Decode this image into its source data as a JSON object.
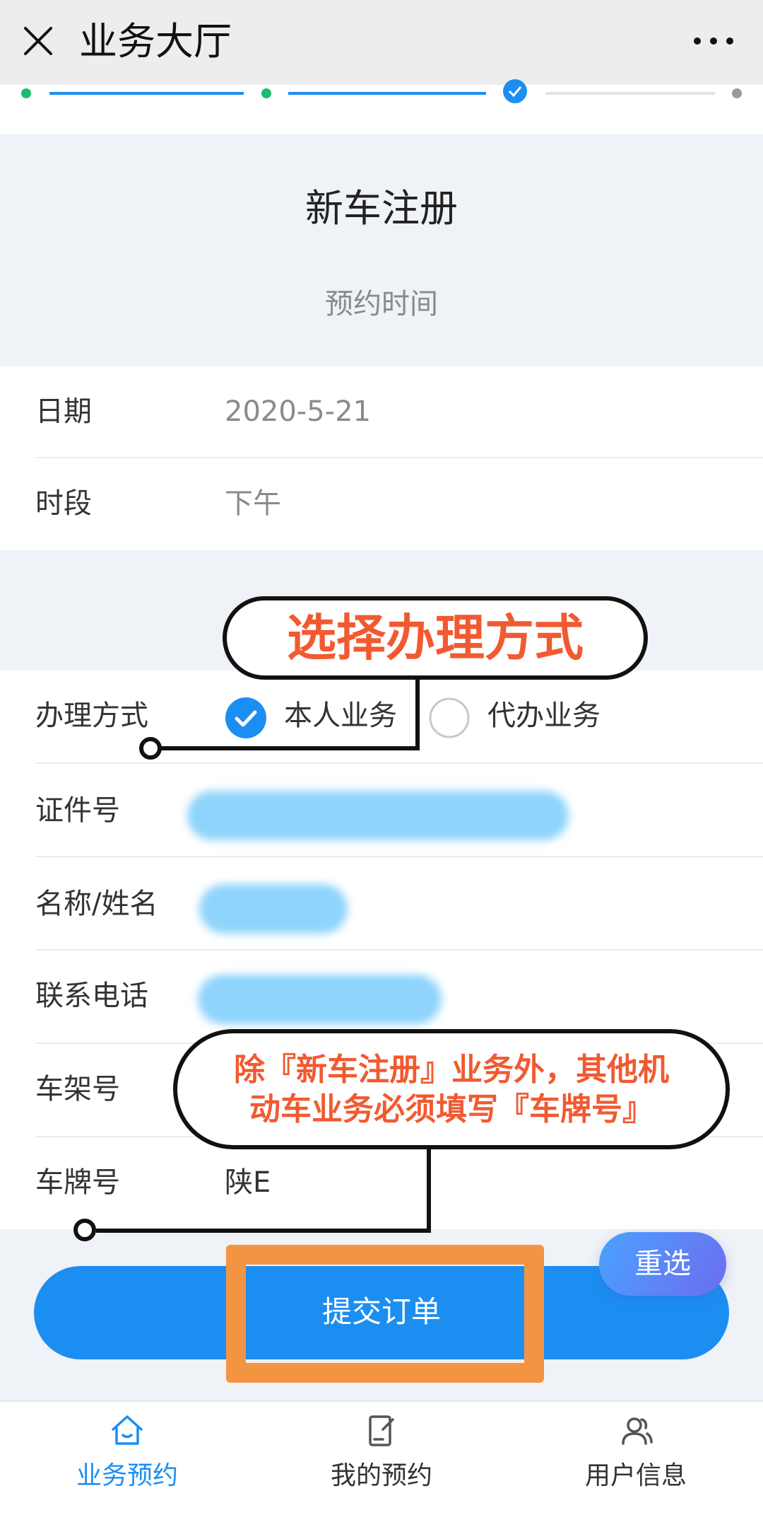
{
  "topbar": {
    "title": "业务大厅"
  },
  "form": {
    "title": "新车注册",
    "subtitle": "预约时间"
  },
  "fields": {
    "date": {
      "label": "日期",
      "value": "2020-5-21"
    },
    "period": {
      "label": "时段",
      "value": "下午"
    },
    "method": {
      "label": "办理方式",
      "options": [
        {
          "label": "本人业务",
          "selected": true
        },
        {
          "label": "代办业务",
          "selected": false
        }
      ]
    },
    "id_number": {
      "label": "证件号"
    },
    "name": {
      "label": "名称/姓名"
    },
    "phone": {
      "label": "联系电话"
    },
    "vin": {
      "label": "车架号"
    },
    "plate": {
      "label": "车牌号",
      "value": "陕E"
    }
  },
  "annotations": {
    "method_callout": "选择办理方式",
    "plate_callout_line1": "除『新车注册』业务外，其他机",
    "plate_callout_line2": "动车业务必须填写『车牌号』"
  },
  "actions": {
    "submit_label": "提交订单",
    "reselect_label": "重选"
  },
  "bottom_nav": {
    "items": [
      {
        "label": "业务预约",
        "icon": "home-icon",
        "active": true
      },
      {
        "label": "我的预约",
        "icon": "document-edit-icon",
        "active": false
      },
      {
        "label": "用户信息",
        "icon": "users-icon",
        "active": false
      }
    ]
  },
  "colors": {
    "accent": "#1c8ef2",
    "callout_text": "#f15a31",
    "highlight_box": "#f39443",
    "step_done": "#19be6b"
  }
}
